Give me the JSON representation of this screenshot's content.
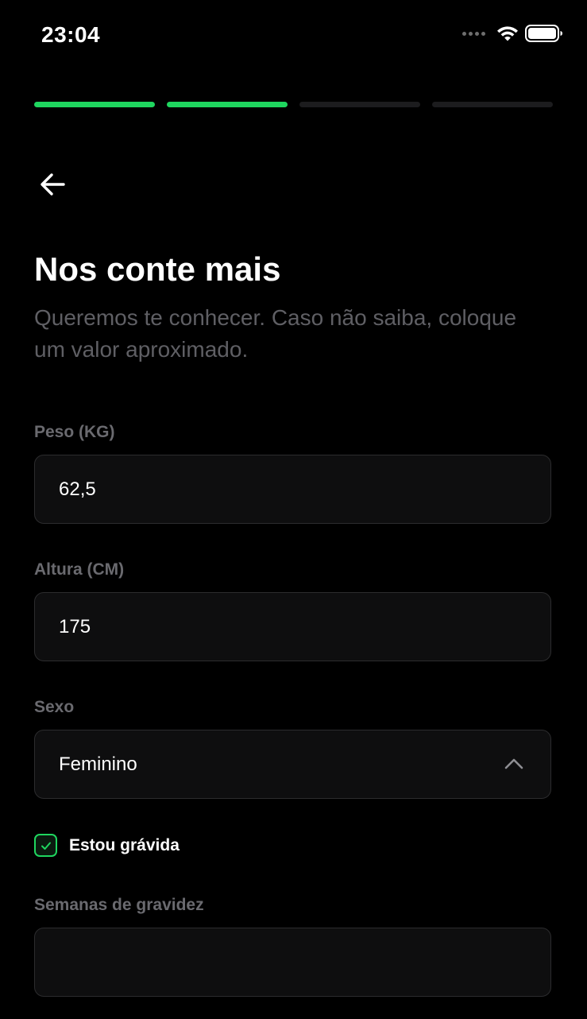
{
  "status_bar": {
    "time": "23:04"
  },
  "progress": {
    "total_steps": 4,
    "completed_steps": 2,
    "active_color": "#1fd65f",
    "inactive_color": "#1c1c1e"
  },
  "header": {
    "back_icon": "arrow-left-icon",
    "title": "Nos conte mais",
    "subtitle": "Queremos te conhecer. Caso não saiba, coloque um valor aproximado."
  },
  "form": {
    "weight": {
      "label": "Peso (KG)",
      "value": "62,5"
    },
    "height": {
      "label": "Altura (CM)",
      "value": "175"
    },
    "sex": {
      "label": "Sexo",
      "value": "Feminino",
      "icon": "chevron-up-icon"
    },
    "pregnant": {
      "label": "Estou grávida",
      "checked": true
    },
    "pregnancy_weeks": {
      "label": "Semanas de gravidez",
      "value": ""
    }
  }
}
